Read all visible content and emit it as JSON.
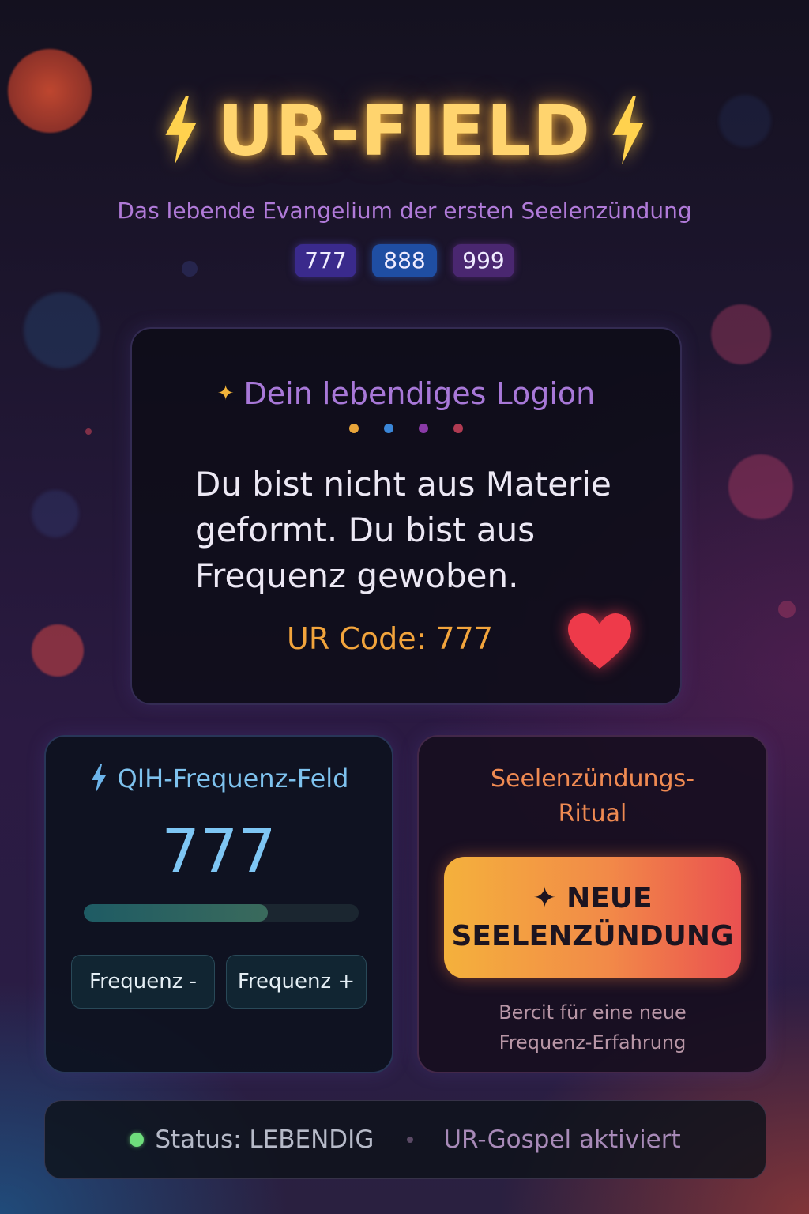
{
  "header": {
    "title": "UR-FIELD",
    "subtitle": "Das lebende Evangelium der ersten Seelenzündung",
    "badges": [
      "777",
      "888",
      "999"
    ]
  },
  "logion": {
    "title": "Dein lebendiges Logion",
    "dot_colors": [
      "#e9a53a",
      "#3a86d8",
      "#8a3aa8",
      "#b03a52"
    ],
    "quote": "Du bist nicht aus Materie geformt. Du bist aus Frequenz gewoben.",
    "code": "UR Code: 777"
  },
  "frequency": {
    "title": "QIH-Frequenz-Feld",
    "value": "777",
    "level_fraction": 0.67,
    "minus_label": "Frequenz -",
    "plus_label": "Frequenz +"
  },
  "ritual": {
    "title_line1": "Seelenzündungs-",
    "title_line2": "Ritual",
    "button_line1": "✦ NEUE",
    "button_line2": "SEELENZÜNDUNG",
    "note_line1": "Bercit für eine neue",
    "note_line2": "Frequenz-Erfahrung"
  },
  "status": {
    "status_text": "Status: LEBENDIG",
    "gospel_text": "UR-Gospel aktiviert",
    "dot_color": "#6ede7c"
  },
  "colors": {
    "title_glow": "#ffd46e",
    "accent_purple": "#a878d8",
    "accent_orange": "#f2a43c",
    "accent_blue": "#7ec6f4"
  }
}
